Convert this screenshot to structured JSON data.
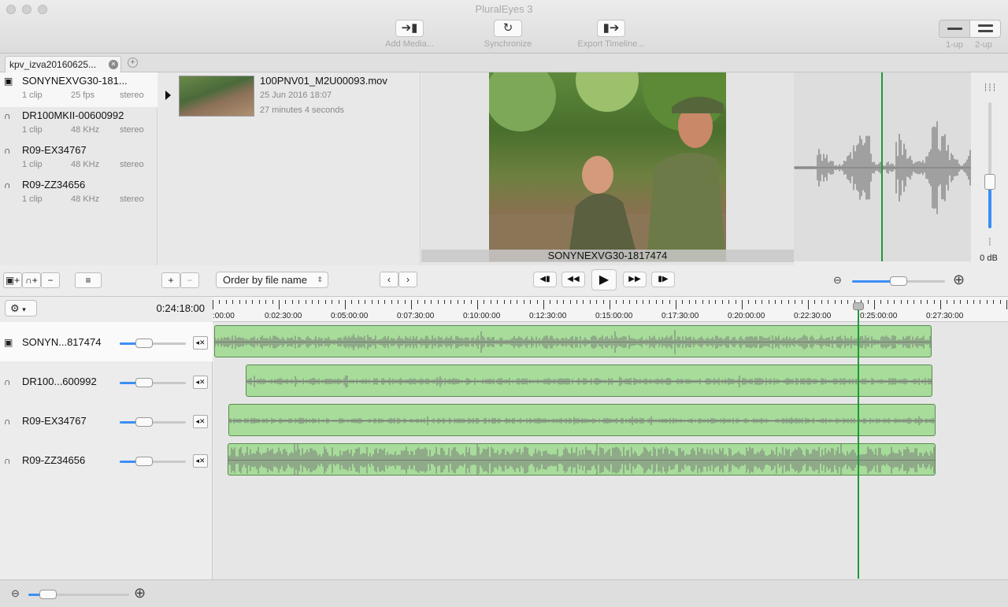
{
  "app": {
    "title": "PluralEyes 3"
  },
  "toolbar": {
    "add_media": "Add Media...",
    "synchronize": "Synchronize",
    "export_timeline": "Export Timeline...",
    "layout_1up": "1-up",
    "layout_2up": "2-up"
  },
  "tabs": [
    {
      "label": "kpv_izva20160625..."
    }
  ],
  "media": [
    {
      "name": "SONYNEXVG30-181...",
      "clips": "1 clip",
      "rate": "25 fps",
      "channels": "stereo",
      "icon": "camera-icon"
    },
    {
      "name": "DR100MKII-00600992",
      "clips": "1 clip",
      "rate": "48 KHz",
      "channels": "stereo",
      "icon": "headphones-icon"
    },
    {
      "name": "R09-EX34767",
      "clips": "1 clip",
      "rate": "48 KHz",
      "channels": "stereo",
      "icon": "headphones-icon"
    },
    {
      "name": "R09-ZZ34656",
      "clips": "1 clip",
      "rate": "48 KHz",
      "channels": "stereo",
      "icon": "headphones-icon"
    }
  ],
  "clip": {
    "filename": "100PNV01_M2U00093.mov",
    "date": "25 Jun 2016 18:07",
    "duration": "27 minutes 4 seconds"
  },
  "viewer": {
    "camera_label": "SONYNEXVG30-1817474",
    "level_db": "0 dB"
  },
  "controls": {
    "order_by": "Order by file name"
  },
  "timeline": {
    "timecode": "0:24:18:00",
    "ruler": [
      ":00:00",
      "0:02:30:00",
      "0:05:00:00",
      "0:07:30:00",
      "0:10:00:00",
      "0:12:30:00",
      "0:15:00:00",
      "0:17:30:00",
      "0:20:00:00",
      "0:22:30:00",
      "0:25:00:00",
      "0:27:30:00"
    ],
    "tracks": [
      {
        "name": "SONYN...817474",
        "icon": "camera-icon",
        "volume": 0.4
      },
      {
        "name": "DR100...600992",
        "icon": "headphones-icon",
        "volume": 0.4
      },
      {
        "name": "R09-EX34767",
        "icon": "headphones-icon",
        "volume": 0.4
      },
      {
        "name": "R09-ZZ34656",
        "icon": "headphones-icon",
        "volume": 0.4
      }
    ]
  },
  "colors": {
    "accent": "#3b8ef5",
    "clip": "#a7dc9a",
    "playhead": "#1e9a36"
  }
}
